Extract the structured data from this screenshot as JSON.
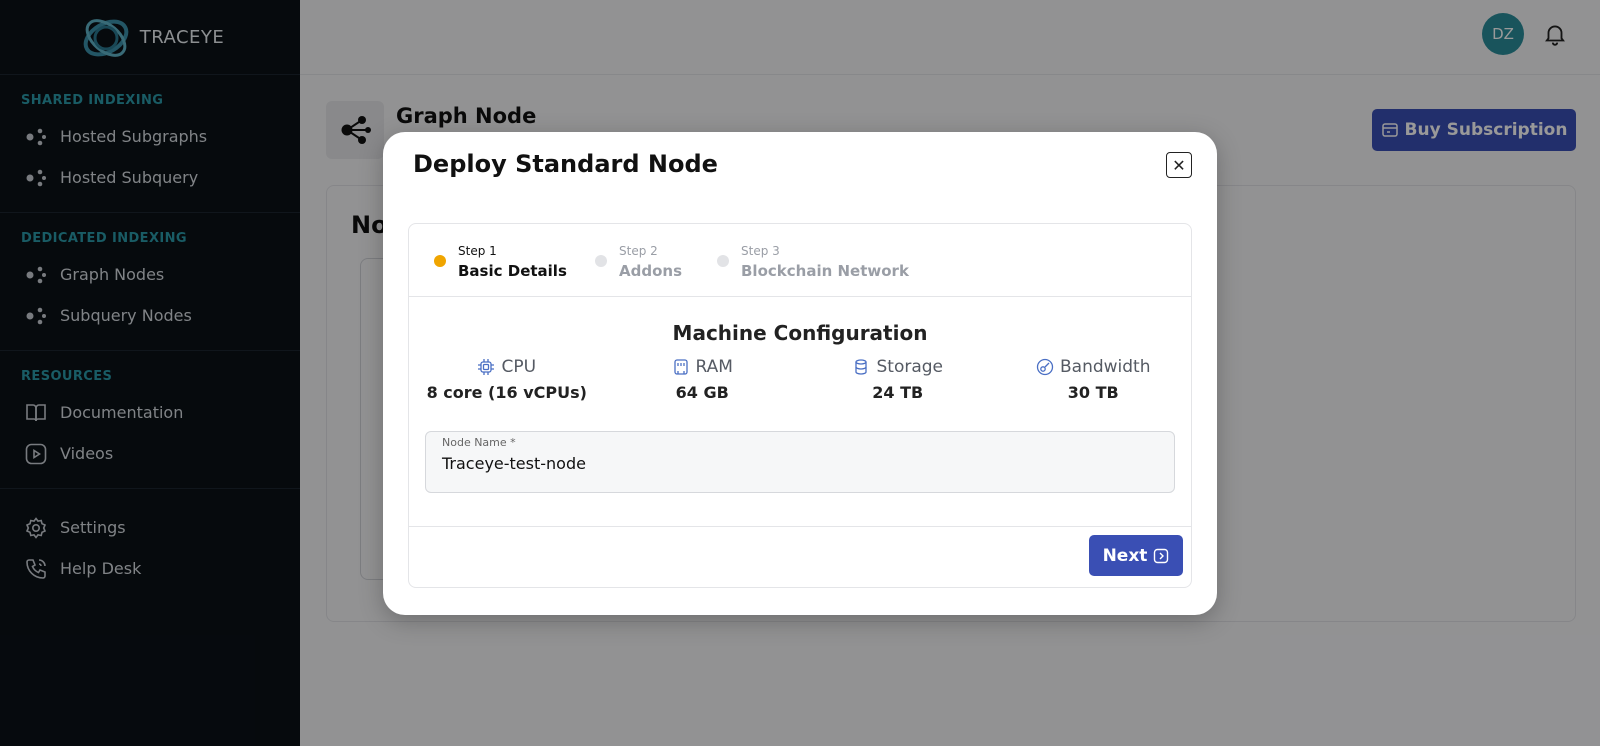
{
  "app": {
    "brand": "TRACEYE"
  },
  "sidebar": {
    "sections": [
      {
        "title": "SHARED INDEXING",
        "items": [
          {
            "label": "Hosted Subgraphs",
            "icon": "nodes-icon"
          },
          {
            "label": "Hosted Subquery",
            "icon": "nodes-icon"
          }
        ]
      },
      {
        "title": "DEDICATED INDEXING",
        "items": [
          {
            "label": "Graph Nodes",
            "icon": "nodes-icon"
          },
          {
            "label": "Subquery Nodes",
            "icon": "nodes-icon"
          }
        ]
      },
      {
        "title": "RESOURCES",
        "items": [
          {
            "label": "Documentation",
            "icon": "book-icon"
          },
          {
            "label": "Videos",
            "icon": "play-icon"
          }
        ]
      }
    ],
    "bottom": [
      {
        "label": "Settings",
        "icon": "gear-icon"
      },
      {
        "label": "Help Desk",
        "icon": "phone-icon"
      }
    ]
  },
  "header": {
    "avatar_initials": "DZ"
  },
  "page": {
    "title": "Graph Node",
    "buy_label": "Buy Subscription",
    "card_title": "No"
  },
  "modal": {
    "title": "Deploy Standard Node",
    "steps": [
      {
        "num": "Step 1",
        "name": "Basic Details",
        "active": true
      },
      {
        "num": "Step 2",
        "name": "Addons",
        "active": false
      },
      {
        "num": "Step 3",
        "name": "Blockchain Network",
        "active": false
      }
    ],
    "config_title": "Machine Configuration",
    "specs": [
      {
        "label": "CPU",
        "value": "8 core (16 vCPUs)",
        "icon": "cpu-icon"
      },
      {
        "label": "RAM",
        "value": "64 GB",
        "icon": "ram-icon"
      },
      {
        "label": "Storage",
        "value": "24 TB",
        "icon": "storage-icon"
      },
      {
        "label": "Bandwidth",
        "value": "30 TB",
        "icon": "bandwidth-icon"
      }
    ],
    "field": {
      "label": "Node Name *",
      "value": "Traceye-test-node"
    },
    "next_label": "Next"
  },
  "colors": {
    "accent": "#3a4fb4",
    "teal": "#2b9aa8",
    "step_active": "#f0a500",
    "step_inactive": "#e2e3e6"
  }
}
